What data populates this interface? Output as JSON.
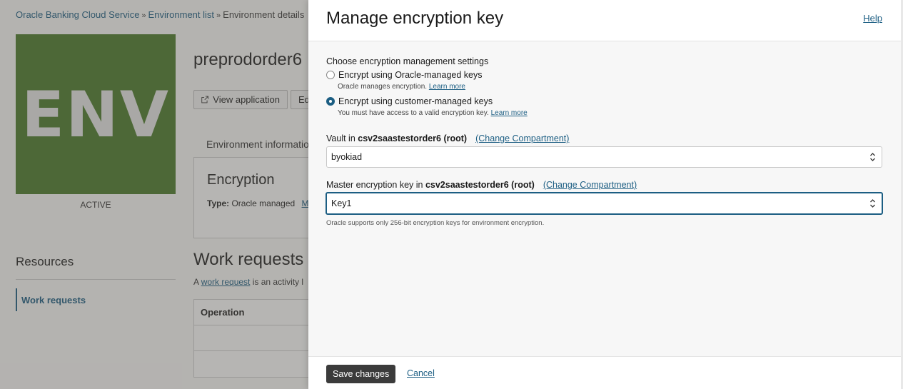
{
  "breadcrumb": {
    "item1": "Oracle Banking Cloud Service",
    "item2": "Environment list",
    "current": "Environment details",
    "separator": "»"
  },
  "environment": {
    "logo_text": "ENV",
    "status": "ACTIVE",
    "name": "preprodorder6",
    "view_application_label": "View application",
    "edit_label_partial": "Ed",
    "tab_info_partial": "Environment informatio",
    "encryption_card": {
      "title": "Encryption",
      "type_label": "Type:",
      "type_value": "Oracle managed",
      "link_partial": "M"
    }
  },
  "resources": {
    "title": "Resources",
    "items": [
      {
        "label": "Work requests"
      }
    ]
  },
  "work_requests": {
    "title": "Work requests",
    "desc_prefix": "A ",
    "desc_link": "work request",
    "desc_suffix": " is an activity l",
    "column_operation": "Operation"
  },
  "panel": {
    "title": "Manage encryption key",
    "help_label": "Help",
    "section_label": "Choose encryption management settings",
    "option_oracle": {
      "label": "Encrypt using Oracle-managed keys",
      "hint": "Oracle manages encryption.",
      "hint_link": "Learn more",
      "selected": false
    },
    "option_customer": {
      "label": "Encrypt using customer-managed keys",
      "hint": "You must have access to a valid encryption key.",
      "hint_link": "Learn more",
      "selected": true
    },
    "vault": {
      "label_prefix": "Vault in ",
      "compartment": "csv2saastestorder6 (root)",
      "change_link": "(Change Compartment)",
      "value": "byokiad"
    },
    "master_key": {
      "label_prefix": "Master encryption key in ",
      "compartment": "csv2saastestorder6 (root)",
      "change_link": "(Change Compartment)",
      "value": "Key1",
      "note": "Oracle supports only 256-bit encryption keys for environment encryption."
    },
    "footer": {
      "save_label": "Save changes",
      "cancel_label": "Cancel"
    }
  },
  "colors": {
    "accent": "#1c5e83",
    "env_logo_bg": "#4a7a2a",
    "primary_button": "#3b3b3b"
  }
}
